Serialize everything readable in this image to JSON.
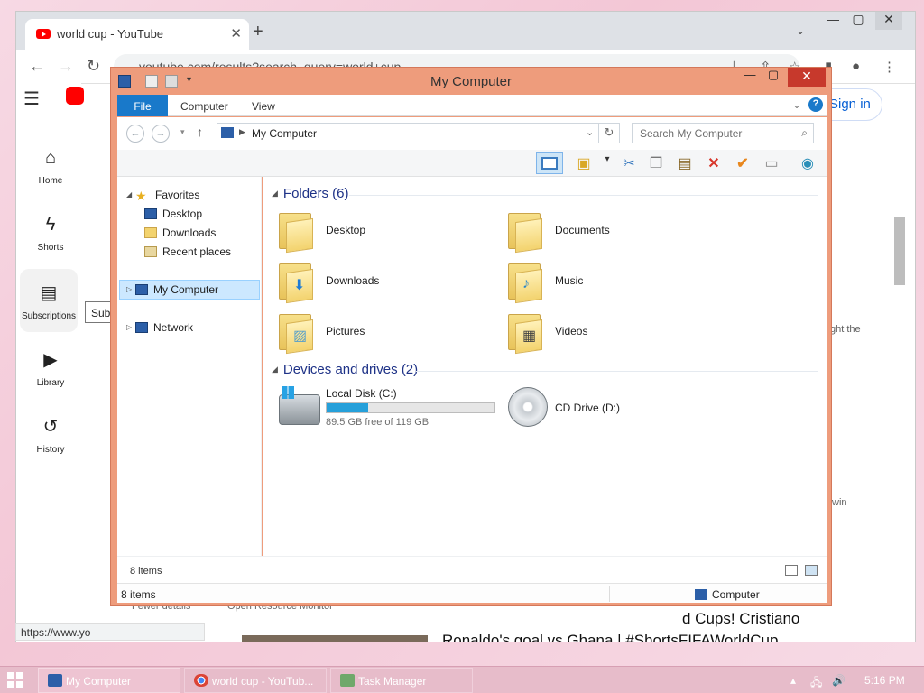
{
  "browser": {
    "tab_title": "world cup - YouTube",
    "tab_close": "✕",
    "newtab": "+",
    "url": "youtube.com/results?search_query=world+cup",
    "status_url": "https://www.yo",
    "window_controls": [
      "—",
      "▢",
      "✕"
    ]
  },
  "youtube": {
    "sidebar": [
      {
        "label": "Home",
        "icon": "home-icon"
      },
      {
        "label": "Shorts",
        "icon": "shorts-icon"
      },
      {
        "label": "Subscriptions",
        "icon": "subscriptions-icon"
      },
      {
        "label": "Library",
        "icon": "library-icon"
      },
      {
        "label": "History",
        "icon": "history-icon"
      }
    ],
    "signin_label": "Sign in",
    "tooltip": "Subscriptions",
    "snippet_1": "ght the",
    "snippet_2": "win",
    "result_title_1": "d Cups! Cristiano",
    "result_title_2": "Ronaldo's goal vs Ghana | #ShortsFIFAWorldCup",
    "behind_1": "Fewer details",
    "behind_2": "Open Resource Monitor"
  },
  "explorer": {
    "title": "My Computer",
    "ribbon_tabs": [
      "File",
      "Computer",
      "View"
    ],
    "address": "My Computer",
    "search_placeholder": "Search My Computer",
    "nav": {
      "favorites": "Favorites",
      "fav_items": [
        "Desktop",
        "Downloads",
        "Recent places"
      ],
      "my_computer": "My Computer",
      "network": "Network"
    },
    "folders_header": "Folders (6)",
    "folders": [
      "Desktop",
      "Documents",
      "Downloads",
      "Music",
      "Pictures",
      "Videos"
    ],
    "devices_header": "Devices and drives (2)",
    "drives": [
      {
        "name": "Local Disk (C:)",
        "free": "89.5 GB free of 119 GB",
        "used_fraction": 0.248
      },
      {
        "name": "CD Drive (D:)"
      }
    ],
    "item_count": "8 items",
    "status_count": "8 items",
    "status_location": "Computer"
  },
  "taskbar": {
    "buttons": [
      "My Computer",
      "world cup - YouTub...",
      "Task Manager"
    ],
    "time": "5:16 PM"
  },
  "colors": {
    "window_frame": "#ee9c7c",
    "accent_blue": "#1979ca",
    "taskbar": "#e7bcca",
    "youtube_red": "#ff0000"
  }
}
